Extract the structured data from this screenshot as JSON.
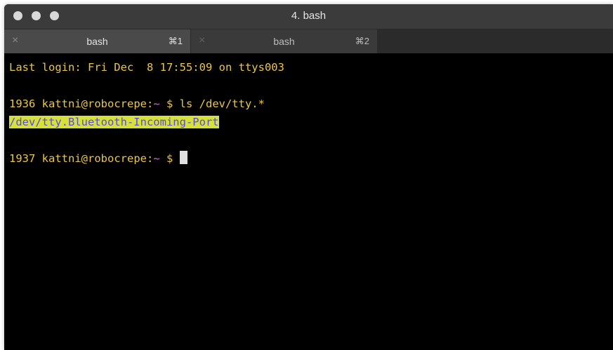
{
  "window": {
    "title": "4. bash"
  },
  "tabs": [
    {
      "label": "bash",
      "shortcut": "⌘1",
      "close_icon": "×"
    },
    {
      "label": "bash",
      "shortcut": "⌘2",
      "close_icon": "×"
    }
  ],
  "terminal": {
    "last_login": "Last login: Fri Dec  8 17:55:09 on ttys003",
    "prompt1": {
      "number": "1936",
      "user_host": "kattni@robocrepe:",
      "path": "~",
      "dollar": " $ ",
      "command": "ls /dev/tty.*"
    },
    "output1": "/dev/tty.Bluetooth-Incoming-Port",
    "prompt2": {
      "number": "1937",
      "user_host": "kattni@robocrepe:",
      "path": "~",
      "dollar": " $ "
    }
  },
  "colors": {
    "prompt_text": "#e8c64a",
    "path_tilde": "#c56fd0",
    "highlight_bg": "#d6e23a",
    "highlight_fg": "#5a4be0",
    "background": "#000000"
  }
}
